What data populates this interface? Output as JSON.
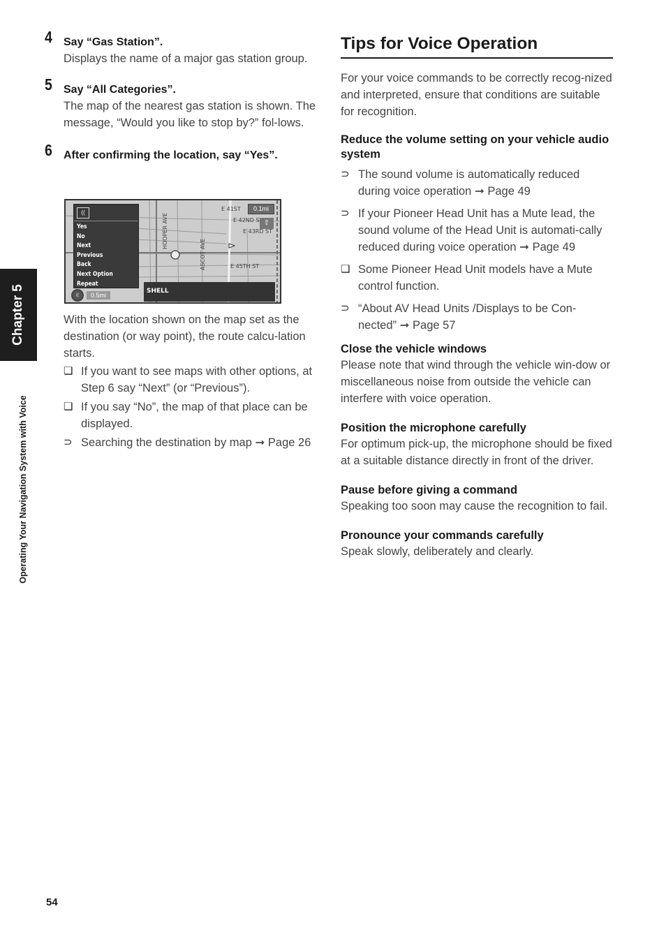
{
  "sidebar": {
    "chapter_label": "Chapter 5",
    "section_caption": "Operating Your Navigation System with Voice"
  },
  "page_number": "54",
  "steps": [
    {
      "number": "4",
      "title": "Say “Gas Station”.",
      "body": "Displays the name of a major gas station group."
    },
    {
      "number": "5",
      "title": "Say “All Categories”.",
      "body": "The map of the nearest gas station is shown. The message, “Would you like to stop by?” fol-lows."
    },
    {
      "number": "6",
      "title": "After confirming the location, say “Yes”.",
      "body": ""
    }
  ],
  "screenshot": {
    "menu_icon": "voice-icon",
    "menu_items": [
      "Yes",
      "No",
      "Next",
      "Previous",
      "Back",
      "Next Option",
      "Repeat"
    ],
    "poi_name": "SHELL",
    "scale": "0.1mi",
    "distance": "0.5mi",
    "streets": [
      "E 41ST",
      "E 42ND ST",
      "E 43RD ST",
      "E 45TH ST",
      "HOOPER AVE",
      "ASCOT AVE"
    ]
  },
  "after_screenshot": {
    "text": "With the location shown on the map set as the destination (or way point), the route calcu-lation starts.",
    "bullets": [
      {
        "icon": "note-icon",
        "mark": "❏",
        "text": "If you want to see maps with other options, at Step 6 say “Next” (or “Previous”)."
      },
      {
        "icon": "note-icon",
        "mark": "❏",
        "text": "If you say “No”, the map of that place can be displayed."
      },
      {
        "icon": "reference-icon",
        "mark": "⊃",
        "text": "Searching the destination by map ➞ Page 26"
      }
    ]
  },
  "tips": {
    "title": "Tips for Voice Operation",
    "intro": "For your voice commands to be correctly recog-nized and interpreted, ensure that conditions are suitable for recognition.",
    "volume": {
      "heading": "Reduce the volume setting on your vehicle audio system",
      "bullets": [
        {
          "icon": "reference-icon",
          "mark": "⊃",
          "text": "The sound volume is automatically reduced during voice operation ➞ Page 49"
        },
        {
          "icon": "reference-icon",
          "mark": "⊃",
          "text": "If your Pioneer Head Unit has a Mute lead, the sound volume of the Head Unit is automati-cally reduced during voice operation ➞ Page 49"
        },
        {
          "icon": "note-icon",
          "mark": "❏",
          "text": "Some Pioneer Head Unit models have a Mute control function."
        },
        {
          "icon": "reference-icon",
          "mark": "⊃",
          "text": "“About AV Head Units /Displays to be Con-nected” ➞ Page 57"
        }
      ]
    },
    "sections": [
      {
        "heading": "Close the vehicle windows",
        "body": "Please note that wind through the vehicle win-dow or miscellaneous noise from outside the vehicle can interfere with voice operation."
      },
      {
        "heading": "Position the microphone carefully",
        "body": "For optimum pick-up, the microphone should be fixed at a suitable distance directly in front of the driver."
      },
      {
        "heading": "Pause before giving a command",
        "body": "Speaking too soon may cause the recognition to fail."
      },
      {
        "heading": "Pronounce your commands carefully",
        "body": "Speak slowly, deliberately and clearly."
      }
    ]
  }
}
